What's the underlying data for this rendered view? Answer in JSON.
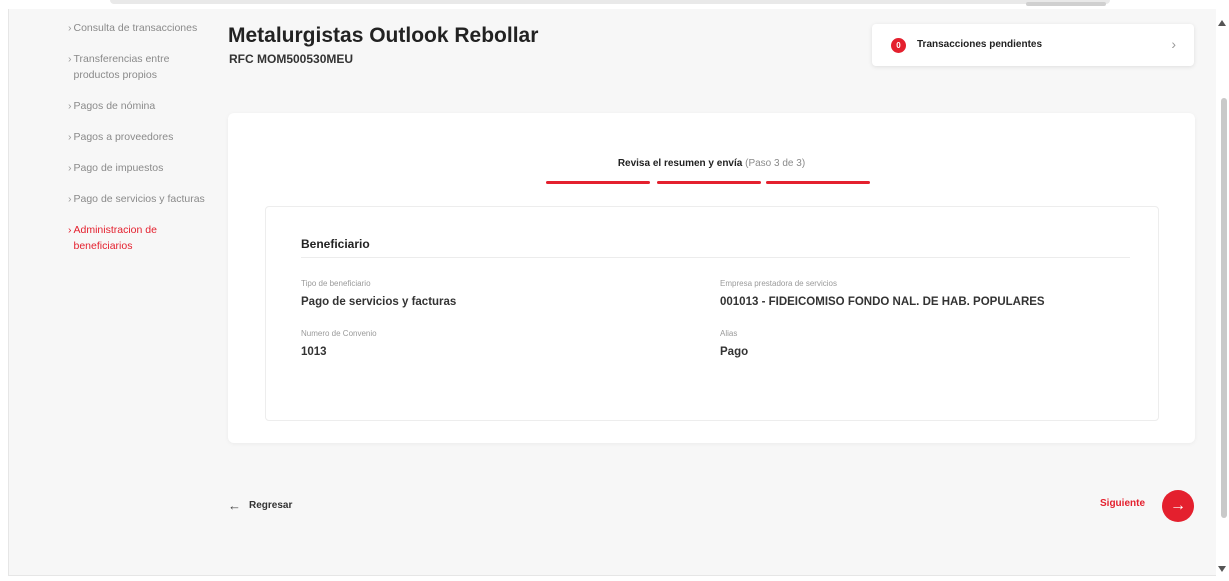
{
  "sidebar": {
    "items": [
      {
        "label": "Consulta de transacciones",
        "active": false
      },
      {
        "label": "Transferencias entre productos propios",
        "active": false
      },
      {
        "label": "Pagos de nómina",
        "active": false
      },
      {
        "label": "Pagos a proveedores",
        "active": false
      },
      {
        "label": "Pago de impuestos",
        "active": false
      },
      {
        "label": "Pago de servicios y facturas",
        "active": false
      },
      {
        "label": "Administracion de beneficiarios",
        "active": true
      }
    ]
  },
  "header": {
    "company": "Metalurgistas Outlook Rebollar",
    "rfc": "RFC MOM500530MEU"
  },
  "pending": {
    "count": "0",
    "label": "Transacciones pendientes"
  },
  "steps": {
    "title": "Revisa el resumen y envía",
    "paso": "(Paso 3 de 3)",
    "total": 3,
    "current": 3
  },
  "beneficiary": {
    "section_title": "Beneficiario",
    "tipo_label": "Tipo de beneficiario",
    "tipo_value": "Pago de servicios y facturas",
    "empresa_label": "Empresa prestadora de servicios",
    "empresa_value": "001013 - FIDEICOMISO FONDO NAL. DE HAB. POPULARES",
    "convenio_label": "Numero de Convenio",
    "convenio_value": "1013",
    "alias_label": "Alias",
    "alias_value": "Pago"
  },
  "nav": {
    "back_label": "Regresar",
    "next_label": "Siguiente"
  },
  "colors": {
    "accent": "#e4202e",
    "background": "#f7f7f7",
    "muted_text": "#8a8a8a"
  },
  "icons": {
    "back": "arrow-left-icon",
    "next": "arrow-right-icon",
    "pending_chevron": "chevron-right-icon",
    "sidebar_chevron": "chevron-right-icon"
  }
}
